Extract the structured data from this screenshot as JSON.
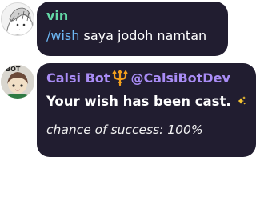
{
  "messages": [
    {
      "sender": "vin",
      "command": "/wish",
      "text": " saya jodoh namtan"
    },
    {
      "avatar_badge": "BOT",
      "sender_name": "Calsi Bot",
      "sender_icon": "trident-icon",
      "sender_handle": "@CalsiBotDev",
      "title": "Your wish has been cast.",
      "title_icon": "sparkles-icon",
      "footer": "chance of success: 100%"
    }
  ],
  "colors": {
    "bubble": "#211d30",
    "vin_name": "#63d8a6",
    "command": "#6db8f5",
    "bot_name": "#a98cf5",
    "trident": "#f3a01c"
  }
}
